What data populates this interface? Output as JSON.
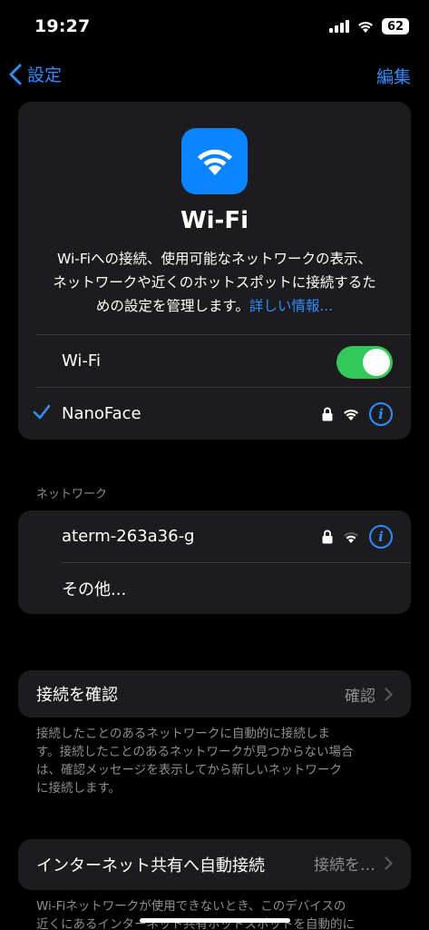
{
  "status": {
    "time": "19:27",
    "battery": "62"
  },
  "nav": {
    "back_label": "設定",
    "edit_label": "編集"
  },
  "hero": {
    "title": "Wi-Fi",
    "description_lines": [
      "Wi-Fiへの接続、使用可能なネットワークの表示、",
      "ネットワークや近くのホットスポットに接続するた",
      "めの設定を管理します。"
    ],
    "link": "詳しい情報..."
  },
  "wifi_row": {
    "label": "Wi-Fi",
    "enabled": true
  },
  "connected": {
    "name": "NanoFace"
  },
  "networks_header": "ネットワーク",
  "networks": [
    {
      "name": "aterm-263a36-g"
    },
    {
      "name": "その他..."
    }
  ],
  "confirm": {
    "label": "接続を確認",
    "value": "確認",
    "footnote_lines": [
      "接続したことのあるネットワークに自動的に接続しま",
      "す。接続したことのあるネットワークが見つからない場合",
      "は、確認メッセージを表示してから新しいネットワーク",
      "に接続します。"
    ]
  },
  "hotspot": {
    "label": "インターネット共有へ自動接続",
    "value": "接続を…",
    "footnote_lines": [
      "Wi-Fiネットワークが使用できないとき、このデバイスの",
      "近くにあるインターネット共有ホットスポットを自動的に"
    ]
  },
  "colors": {
    "accent": "#2f8dff",
    "toggle_on": "#34c759",
    "card": "#1c1c1e"
  }
}
